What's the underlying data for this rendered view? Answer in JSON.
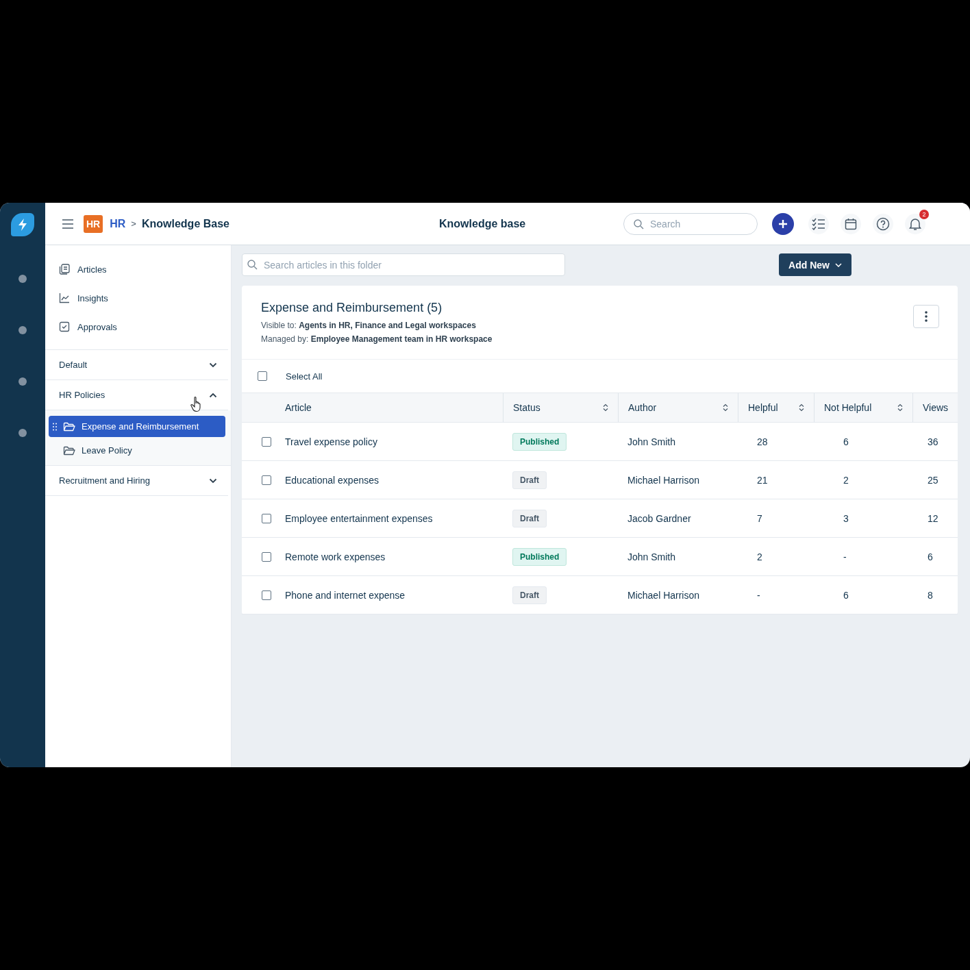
{
  "breadcrumb": {
    "workspace_badge": "HR",
    "workspace": "HR",
    "separator": ">",
    "page": "Knowledge Base"
  },
  "header": {
    "title": "Knowledge base",
    "search": {
      "placeholder": "Search"
    },
    "notification_count": "2"
  },
  "sidebar": {
    "nav": [
      {
        "label": "Articles",
        "kind": "articles"
      },
      {
        "label": "Insights",
        "kind": "insights"
      },
      {
        "label": "Approvals",
        "kind": "approvals"
      }
    ],
    "sections": [
      {
        "label": "Default",
        "expanded": false
      },
      {
        "label": "HR Policies",
        "expanded": true,
        "folders": [
          {
            "label": "Expense and Reimbursement",
            "selected": true
          },
          {
            "label": "Leave Policy",
            "selected": false
          }
        ]
      },
      {
        "label": "Recruitment and Hiring",
        "expanded": false
      }
    ]
  },
  "toolbar": {
    "search": {
      "placeholder": "Search articles in this folder"
    },
    "add_button": "Add New"
  },
  "folder": {
    "title": "Expense and Reimbursement (5)",
    "visible_label": "Visible to:",
    "visible_to": "Agents in HR, Finance and Legal workspaces",
    "managed_label": "Managed by:",
    "managed_by": "Employee Management team in HR workspace"
  },
  "table": {
    "select_all": {
      "label": "Select All",
      "checked": false
    },
    "columns": [
      {
        "label": "Article",
        "sortable": false
      },
      {
        "label": "Status",
        "sortable": true
      },
      {
        "label": "Author",
        "sortable": true
      },
      {
        "label": "Helpful",
        "sortable": true
      },
      {
        "label": "Not Helpful",
        "sortable": true
      },
      {
        "label": "Views",
        "sortable": false
      }
    ],
    "rows": [
      {
        "checked": false,
        "article": "Travel expense policy",
        "status": {
          "label": "Published",
          "kind": "published"
        },
        "author": "John Smith",
        "helpful": "28",
        "not_helpful": "6",
        "views": "36"
      },
      {
        "checked": false,
        "article": "Educational expenses",
        "status": {
          "label": "Draft",
          "kind": "draft"
        },
        "author": "Michael Harrison",
        "helpful": "21",
        "not_helpful": "2",
        "views": "25"
      },
      {
        "checked": false,
        "article": "Employee entertainment expenses",
        "status": {
          "label": "Draft",
          "kind": "draft"
        },
        "author": "Jacob Gardner",
        "helpful": "7",
        "not_helpful": "3",
        "views": "12"
      },
      {
        "checked": false,
        "article": "Remote work expenses",
        "status": {
          "label": "Published",
          "kind": "published"
        },
        "author": "John Smith",
        "helpful": "2",
        "not_helpful": "-",
        "views": "6"
      },
      {
        "checked": false,
        "article": "Phone and internet expense",
        "status": {
          "label": "Draft",
          "kind": "draft"
        },
        "author": "Michael Harrison",
        "helpful": "-",
        "not_helpful": "6",
        "views": "8"
      }
    ]
  }
}
